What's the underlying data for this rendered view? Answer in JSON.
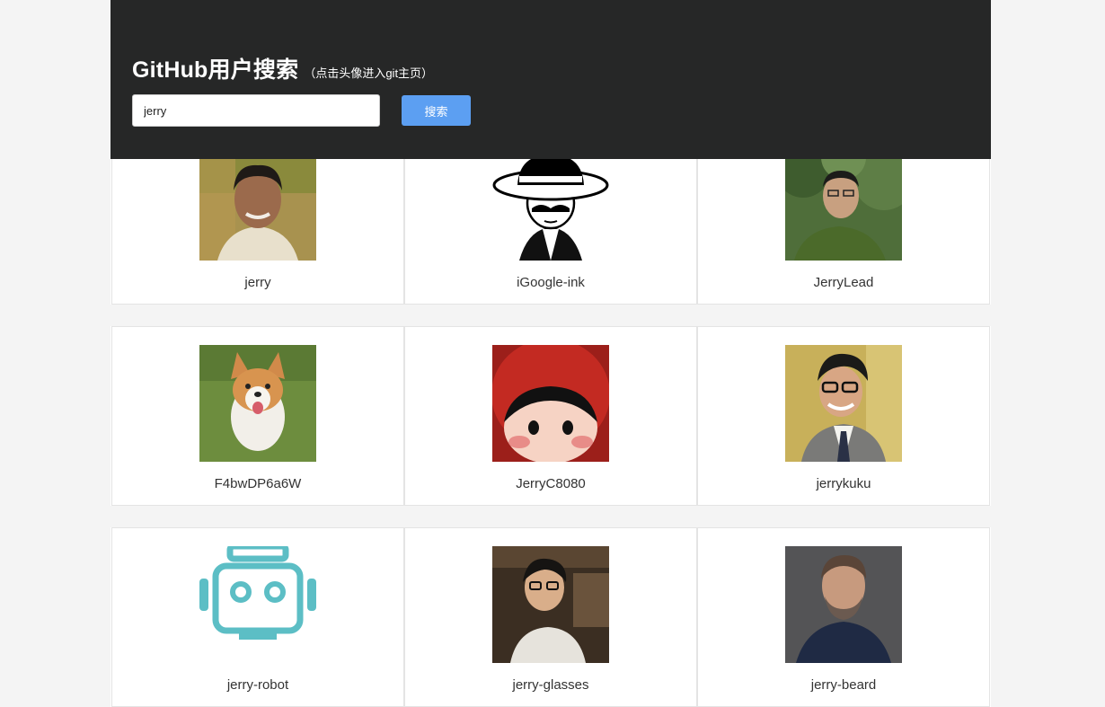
{
  "header": {
    "title": "GitHub用户搜索",
    "subtitle": "（点击头像进入git主页）"
  },
  "search": {
    "value": "jerry",
    "button_label": "搜索"
  },
  "users": [
    {
      "login": "jerry"
    },
    {
      "login": "iGoogle-ink"
    },
    {
      "login": "JerryLead"
    },
    {
      "login": "F4bwDP6a6W"
    },
    {
      "login": "JerryC8080"
    },
    {
      "login": "jerrykuku"
    },
    {
      "login": "jerry-robot"
    },
    {
      "login": "jerry-glasses"
    },
    {
      "login": "jerry-beard"
    }
  ]
}
